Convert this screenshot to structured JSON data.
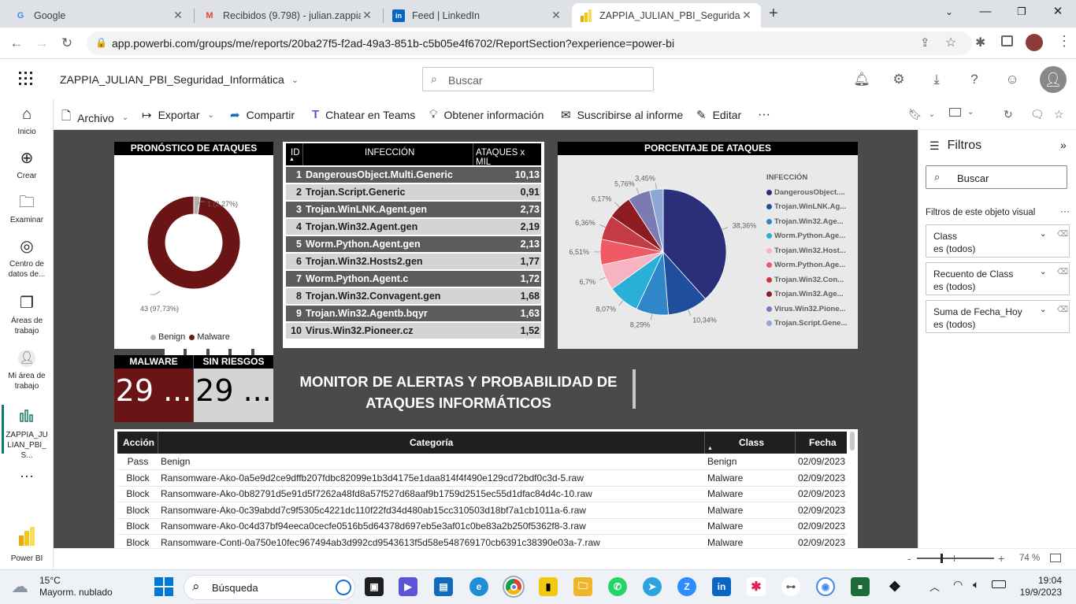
{
  "browser": {
    "tabs": [
      {
        "title": "Google",
        "icon": "google-icon",
        "color": "#4285f4"
      },
      {
        "title": "Recibidos (9.798) - julian.zappia@",
        "icon": "gmail-icon",
        "color": "#ea4335"
      },
      {
        "title": "Feed | LinkedIn",
        "icon": "linkedin-icon",
        "color": "#0a66c2"
      },
      {
        "title": "ZAPPIA_JULIAN_PBI_Seguridad_I",
        "icon": "powerbi-icon",
        "color": "#f2c811"
      }
    ],
    "url": "app.powerbi.com/groups/me/reports/20ba27f5-f2ad-49a3-851b-c5b05e4f6702/ReportSection?experience=power-bi"
  },
  "pbi": {
    "report_title": "ZAPPIA_JULIAN_PBI_Seguridad_Informática",
    "search_placeholder": "Buscar",
    "rail": [
      {
        "label": "Inicio",
        "icon": "home-icon"
      },
      {
        "label": "Crear",
        "icon": "plus-circle-icon"
      },
      {
        "label": "Examinar",
        "icon": "folder-icon"
      },
      {
        "label": "Centro de datos de...",
        "icon": "data-hub-icon"
      },
      {
        "label": "Áreas de trabajo",
        "icon": "workspaces-icon"
      },
      {
        "label": "Mi área de trabajo",
        "icon": "my-workspace-icon"
      },
      {
        "label": "ZAPPIA_JULIAN_PBI_S...",
        "icon": "report-icon"
      },
      {
        "label": "Power BI",
        "icon": "powerbi-logo"
      }
    ],
    "commands": {
      "archivo": "Archivo",
      "exportar": "Exportar",
      "compartir": "Compartir",
      "teams": "Chatear en Teams",
      "info": "Obtener información",
      "suscribirse": "Suscribirse al informe",
      "editar": "Editar"
    }
  },
  "visuals": {
    "donut": {
      "title": "PRONÓSTICO DE ATAQUES",
      "label_small": "1 (2,27%)",
      "label_big": "43 (97,73%)",
      "legend": [
        {
          "name": "Benign",
          "color": "#b3b0ad"
        },
        {
          "name": "Malware",
          "color": "#6b1416"
        }
      ]
    },
    "ranking": {
      "headers": [
        "ID",
        "INFECCIÓN",
        "ATAQUES x MIL"
      ],
      "rows": [
        {
          "id": "1",
          "name": "DangerousObject.Multi.Generic",
          "value": "10,13"
        },
        {
          "id": "2",
          "name": "Trojan.Script.Generic",
          "value": "0,91"
        },
        {
          "id": "3",
          "name": "Trojan.WinLNK.Agent.gen",
          "value": "2,73"
        },
        {
          "id": "4",
          "name": "Trojan.Win32.Agent.gen",
          "value": "2,19"
        },
        {
          "id": "5",
          "name": "Worm.Python.Agent.gen",
          "value": "2,13"
        },
        {
          "id": "6",
          "name": "Trojan.Win32.Hosts2.gen",
          "value": "1,77"
        },
        {
          "id": "7",
          "name": "Worm.Python.Agent.c",
          "value": "1,72"
        },
        {
          "id": "8",
          "name": "Trojan.Win32.Convagent.gen",
          "value": "1,68"
        },
        {
          "id": "9",
          "name": "Trojan.Win32.Agentb.bqyr",
          "value": "1,63"
        },
        {
          "id": "10",
          "name": "Virus.Win32.Pioneer.cz",
          "value": "1,52"
        }
      ]
    },
    "pie": {
      "title": "PORCENTAJE DE ATAQUES",
      "legend_title": "INFECCIÓN",
      "legend": [
        {
          "name": "DangerousObject....",
          "color": "#2b2f7a"
        },
        {
          "name": "Trojan.WinLNK.Ag...",
          "color": "#1f4e9c"
        },
        {
          "name": "Trojan.Win32.Age...",
          "color": "#2f86c8"
        },
        {
          "name": "Worm.Python.Age...",
          "color": "#2ab0d6"
        },
        {
          "name": "Trojan.Win32.Host...",
          "color": "#f7b3c2"
        },
        {
          "name": "Worm.Python.Age...",
          "color": "#ef5a64"
        },
        {
          "name": "Trojan.Win32.Con...",
          "color": "#c43b44"
        },
        {
          "name": "Trojan.Win32.Age...",
          "color": "#8c1c22"
        },
        {
          "name": "Virus.Win32.Pione...",
          "color": "#7c7ab3"
        },
        {
          "name": "Trojan.Script.Gene...",
          "color": "#8ea6d6"
        }
      ],
      "labels": [
        "38,36%",
        "10,34%",
        "8,29%",
        "8,07%",
        "6,7%",
        "6,51%",
        "6,36%",
        "6,17%",
        "5,76%",
        "3,45%"
      ]
    },
    "cards": {
      "malware_title": "MALWARE",
      "malware_value": "29 ...",
      "sinriesgo_title": "SIN RIESGOS",
      "sinriesgo_value": "29 ..."
    },
    "banner": "MONITOR DE ALERTAS Y PROBABILIDAD DE ATAQUES INFORMÁTICOS",
    "table": {
      "headers": [
        "Acción",
        "Categoría",
        "Class",
        "Fecha"
      ],
      "rows": [
        {
          "accion": "Pass",
          "categoria": "Benign",
          "class": "Benign",
          "fecha": "02/09/2023"
        },
        {
          "accion": "Block",
          "categoria": "Ransomware-Ako-0a5e9d2ce9dffb207fdbc82099e1b3d4175e1daa814f4f490e129cd72bdf0c3d-5.raw",
          "class": "Malware",
          "fecha": "02/09/2023"
        },
        {
          "accion": "Block",
          "categoria": "Ransomware-Ako-0b82791d5e91d5f7262a48fd8a57f527d68aaf9b1759d2515ec55d1dfac84d4c-10.raw",
          "class": "Malware",
          "fecha": "02/09/2023"
        },
        {
          "accion": "Block",
          "categoria": "Ransomware-Ako-0c39abdd7c9f5305c4221dc110f22fd34d480ab15cc310503d18bf7a1cb1011a-6.raw",
          "class": "Malware",
          "fecha": "02/09/2023"
        },
        {
          "accion": "Block",
          "categoria": "Ransomware-Ako-0c4d37bf94eeca0cecfe0516b5d64378d697eb5e3af01c0be83a2b250f5362f8-3.raw",
          "class": "Malware",
          "fecha": "02/09/2023"
        },
        {
          "accion": "Block",
          "categoria": "Ransomware-Conti-0a750e10fec967494ab3d992cd9543613f5d58e548769170cb6391c38390e03a-7.raw",
          "class": "Malware",
          "fecha": "02/09/2023"
        }
      ]
    }
  },
  "filters": {
    "title": "Filtros",
    "search_placeholder": "Buscar",
    "section": "Filtros de este objeto visual",
    "items": [
      {
        "name": "Class",
        "value": "es (todos)"
      },
      {
        "name": "Recuento de Class",
        "value": "es (todos)"
      },
      {
        "name": "Suma de Fecha_Hoy",
        "value": "es (todos)"
      }
    ]
  },
  "status": {
    "zoom": "74 %"
  },
  "taskbar": {
    "weather_temp": "15°C",
    "weather_desc": "Mayorm. nublado",
    "search_placeholder": "Búsqueda",
    "time": "19:04",
    "date": "19/9/2023"
  },
  "chart_data": [
    {
      "type": "pie",
      "title": "PRONÓSTICO DE ATAQUES",
      "categories": [
        "Benign",
        "Malware"
      ],
      "values": [
        1,
        43
      ],
      "percentages": [
        2.27,
        97.73
      ]
    },
    {
      "type": "table",
      "title": "",
      "columns": [
        "ID",
        "INFECCIÓN",
        "ATAQUES x MIL"
      ],
      "rows": [
        [
          1,
          "DangerousObject.Multi.Generic",
          10.13
        ],
        [
          2,
          "Trojan.Script.Generic",
          0.91
        ],
        [
          3,
          "Trojan.WinLNK.Agent.gen",
          2.73
        ],
        [
          4,
          "Trojan.Win32.Agent.gen",
          2.19
        ],
        [
          5,
          "Worm.Python.Agent.gen",
          2.13
        ],
        [
          6,
          "Trojan.Win32.Hosts2.gen",
          1.77
        ],
        [
          7,
          "Worm.Python.Agent.c",
          1.72
        ],
        [
          8,
          "Trojan.Win32.Convagent.gen",
          1.68
        ],
        [
          9,
          "Trojan.Win32.Agentb.bqyr",
          1.63
        ],
        [
          10,
          "Virus.Win32.Pioneer.cz",
          1.52
        ]
      ]
    },
    {
      "type": "pie",
      "title": "PORCENTAJE DE ATAQUES",
      "legend_title": "INFECCIÓN",
      "values": [
        38.36,
        10.34,
        8.29,
        8.07,
        6.7,
        6.51,
        6.36,
        6.17,
        5.76,
        3.45
      ]
    }
  ]
}
